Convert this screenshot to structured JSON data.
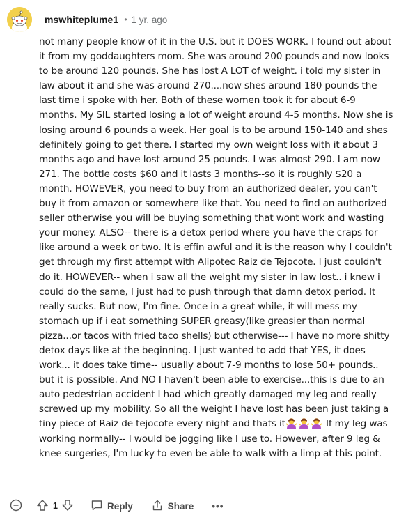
{
  "comment": {
    "author": "mswhiteplume1",
    "separator": "•",
    "age": "1 yr. ago",
    "avatar_icon": "snoo-avatar-icon",
    "avatar_color": "#f2d04b",
    "body_before_emoji": "not many people know of it in the U.S. but it DOES WORK. I found out about it from my goddaughters mom. She was around 200 pounds and now looks to be around 120 pounds. She has lost A LOT of weight. i told my sister in law about it and she was around 270....now shes around 180 pounds the last time i spoke with her. Both of these women took it for about 6-9 months. My SIL started losing a lot of weight around 4-5 months. Now she is losing around 6 pounds a week. Her goal is to be around 150-140 and shes definitely going to get there. I started my own weight loss with it about 3 months ago and have lost around 25 pounds. I was almost 290. I am now 271. The bottle costs $60 and it lasts 3 months--so it is roughly $20 a month. HOWEVER, you need to buy from an authorized dealer, you can't buy it from amazon or somewhere like that. You need to find an authorized seller otherwise you will be buying something that wont work and wasting your money. ALSO-- there is a detox period where you have the craps for like around a week or two. It is effin awful and it is the reason why I couldn't get through my first attempt with Alipotec Raiz de Tejocote. I just couldn't do it. HOWEVER-- when i saw all the weight my sister in law lost.. i knew i could do the same, I just had to push through that damn detox period. It really sucks. But now, I'm fine. Once in a great while, it will mess my stomach up if i eat something SUPER greasy(like greasier than normal pizza...or tacos with fried taco shells) but otherwise--- I have no more shitty detox days like at the beginning. I just wanted to add that YES, it does work... it does take time-- usually about 7-9 months to lose 50+ pounds.. but it is possible. And NO I haven't been able to exercise...this is due to an auto pedestrian accident I had which greatly damaged my leg and really screwed up my mobility. So all the weight I have lost has been just taking a tiny piece of Raiz de tejocote every night and thats it",
    "emoji": [
      "🤷‍♀️",
      "🤷‍♀️",
      "🤷‍♀️"
    ],
    "body_after_emoji": " If my leg was working normally-- I would be jogging like I use to. However, after 9 leg & knee surgeries, I'm lucky to even be able to walk with a limp at this point."
  },
  "actions": {
    "collapse_icon": "collapse-circle-minus-icon",
    "upvote_icon": "upvote-arrow-icon",
    "vote_count": "1",
    "downvote_icon": "downvote-arrow-icon",
    "reply_label": "Reply",
    "reply_icon": "speech-bubble-icon",
    "share_label": "Share",
    "share_icon": "share-arrow-icon",
    "more_label": "•••"
  }
}
